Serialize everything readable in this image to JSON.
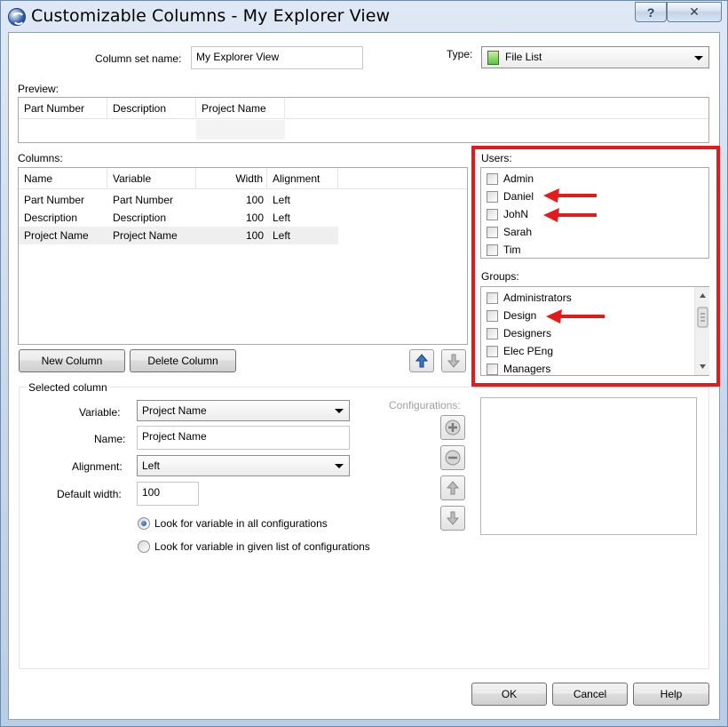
{
  "window": {
    "title": "Customizable Columns - My Explorer View",
    "help_glyph": "?",
    "close_glyph": "✕"
  },
  "header": {
    "column_set_name_label": "Column set name:",
    "column_set_name_value": "My Explorer View",
    "type_label": "Type:",
    "type_value": "File List"
  },
  "preview": {
    "label": "Preview:",
    "columns": [
      "Part Number",
      "Description",
      "Project Name"
    ]
  },
  "columns": {
    "label": "Columns:",
    "headers": [
      "Name",
      "Variable",
      "Width",
      "Alignment"
    ],
    "rows": [
      {
        "name": "Part Number",
        "variable": "Part Number",
        "width": "100",
        "alignment": "Left"
      },
      {
        "name": "Description",
        "variable": "Description",
        "width": "100",
        "alignment": "Left"
      },
      {
        "name": "Project Name",
        "variable": "Project Name",
        "width": "100",
        "alignment": "Left"
      }
    ],
    "new_column_label": "New Column",
    "delete_column_label": "Delete Column"
  },
  "users": {
    "label": "Users:",
    "items": [
      "Admin",
      "Daniel",
      "JohN",
      "Sarah",
      "Tim"
    ]
  },
  "groups": {
    "label": "Groups:",
    "items": [
      "Administrators",
      "Design",
      "Designers",
      "Elec PEng",
      "Managers"
    ]
  },
  "selected_column": {
    "label": "Selected column",
    "variable_label": "Variable:",
    "variable_value": "Project Name",
    "name_label": "Name:",
    "name_value": "Project Name",
    "alignment_label": "Alignment:",
    "alignment_value": "Left",
    "default_width_label": "Default width:",
    "default_width_value": "100",
    "radio_all_label": "Look for variable in all configurations",
    "radio_given_label": "Look for variable in given list of configurations",
    "configurations_label": "Configurations:"
  },
  "footer": {
    "ok_label": "OK",
    "cancel_label": "Cancel",
    "help_label": "Help"
  },
  "colors": {
    "highlight": "#e31b1b",
    "accent": "#2c5fa8"
  }
}
